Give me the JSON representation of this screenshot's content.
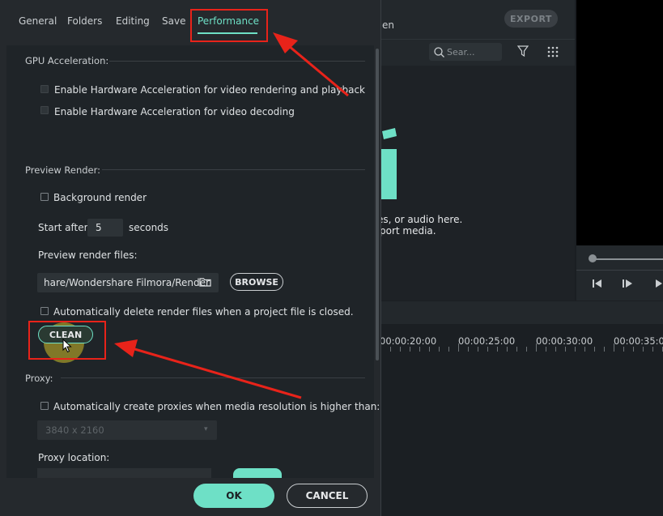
{
  "app": {
    "export_label": "EXPORT",
    "tab_fragment": "en",
    "search_placeholder": "Sear...",
    "import_text_line1": "es, or audio here.",
    "import_text_line2": "port media.",
    "timecodes": [
      "00:00:20:00",
      "00:00:25:00",
      "00:00:30:00",
      "00:00:35:00"
    ]
  },
  "dialog": {
    "tabs": [
      "General",
      "Folders",
      "Editing",
      "Save",
      "Performance"
    ],
    "active_tab": "Performance",
    "gpu": {
      "title": "GPU Acceleration:",
      "option1": "Enable Hardware Acceleration for video rendering and playback",
      "option2": "Enable Hardware Acceleration for video decoding"
    },
    "preview_render": {
      "title": "Preview Render:",
      "background_render": "Background render",
      "start_after_label": "Start after",
      "start_after_value": "5",
      "seconds_label": "seconds",
      "files_label": "Preview render files:",
      "files_path": "hare/Wondershare Filmora/Render",
      "browse_label": "BROWSE",
      "auto_delete": "Automatically delete render files when a project file is closed.",
      "clean_label": "CLEAN"
    },
    "proxy": {
      "title": "Proxy:",
      "auto_create": "Automatically create proxies when media resolution is higher than:",
      "resolution": "3840 x 2160",
      "location_label": "Proxy location:"
    },
    "ok_label": "OK",
    "cancel_label": "CANCEL"
  },
  "colors": {
    "accent": "#6ee0c6",
    "annotation_red": "#e8231a",
    "panel_bg": "#1f2428",
    "dialog_bg": "#25292d"
  }
}
